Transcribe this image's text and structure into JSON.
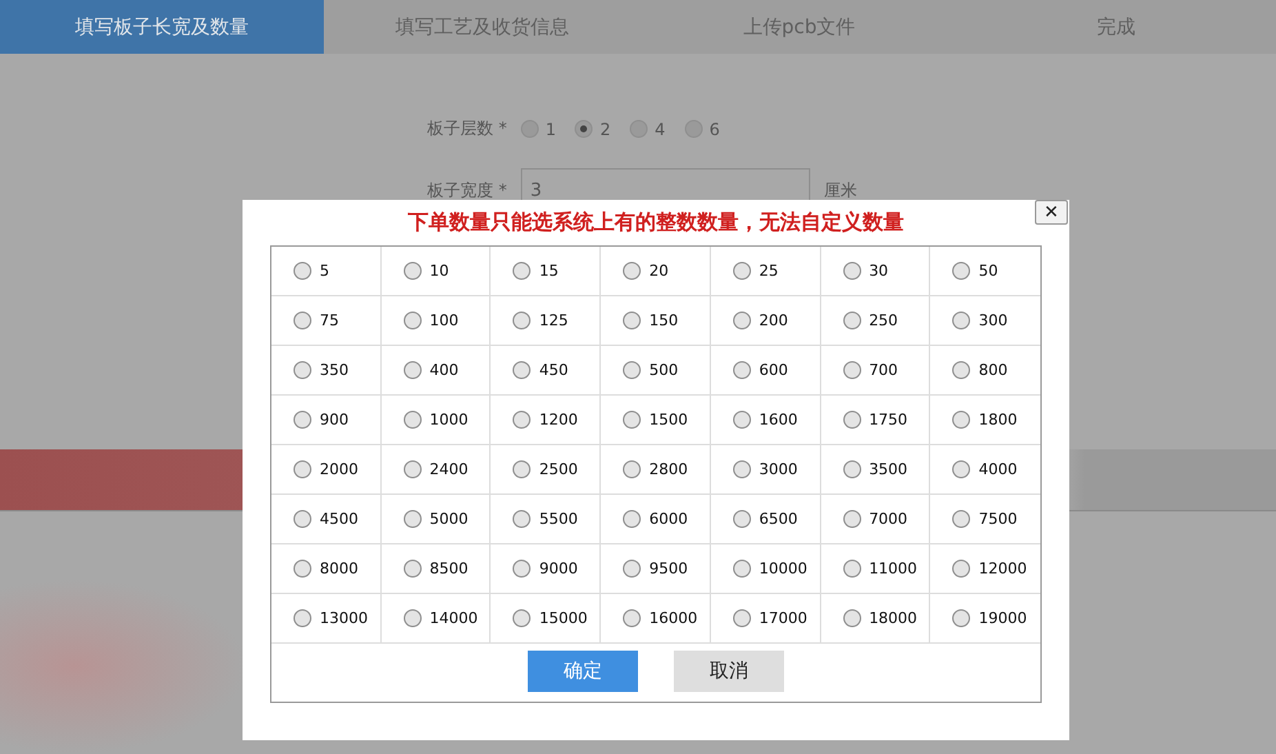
{
  "tabs": [
    {
      "label": "填写板子长宽及数量",
      "selected": true
    },
    {
      "label": "填写工艺及收货信息",
      "selected": false
    },
    {
      "label": "上传pcb文件",
      "selected": false
    },
    {
      "label": "完成",
      "selected": false
    }
  ],
  "form": {
    "layers": {
      "label": "板子层数 *",
      "options": [
        {
          "label": "1",
          "selected": false
        },
        {
          "label": "2",
          "selected": true
        },
        {
          "label": "4",
          "selected": false
        },
        {
          "label": "6",
          "selected": false
        }
      ]
    },
    "width": {
      "label": "板子宽度 *",
      "value": "3",
      "unit": "厘米"
    }
  },
  "modal": {
    "title": "下单数量只能选系统上有的整数数量，无法自定义数量",
    "close": "✕",
    "options": [
      {
        "label": "5",
        "selected": false
      },
      {
        "label": "10",
        "selected": false
      },
      {
        "label": "15",
        "selected": false
      },
      {
        "label": "20",
        "selected": false
      },
      {
        "label": "25",
        "selected": false
      },
      {
        "label": "30",
        "selected": false
      },
      {
        "label": "50",
        "selected": false
      },
      {
        "label": "75",
        "selected": false
      },
      {
        "label": "100",
        "selected": false
      },
      {
        "label": "125",
        "selected": false
      },
      {
        "label": "150",
        "selected": false
      },
      {
        "label": "200",
        "selected": false
      },
      {
        "label": "250",
        "selected": false
      },
      {
        "label": "300",
        "selected": false
      },
      {
        "label": "350",
        "selected": false
      },
      {
        "label": "400",
        "selected": false
      },
      {
        "label": "450",
        "selected": false
      },
      {
        "label": "500",
        "selected": false
      },
      {
        "label": "600",
        "selected": false
      },
      {
        "label": "700",
        "selected": false
      },
      {
        "label": "800",
        "selected": false
      },
      {
        "label": "900",
        "selected": false
      },
      {
        "label": "1000",
        "selected": false
      },
      {
        "label": "1200",
        "selected": false
      },
      {
        "label": "1500",
        "selected": false
      },
      {
        "label": "1600",
        "selected": false
      },
      {
        "label": "1750",
        "selected": false
      },
      {
        "label": "1800",
        "selected": false
      },
      {
        "label": "2000",
        "selected": false
      },
      {
        "label": "2400",
        "selected": false
      },
      {
        "label": "2500",
        "selected": false
      },
      {
        "label": "2800",
        "selected": false
      },
      {
        "label": "3000",
        "selected": false
      },
      {
        "label": "3500",
        "selected": false
      },
      {
        "label": "4000",
        "selected": false
      },
      {
        "label": "4500",
        "selected": false
      },
      {
        "label": "5000",
        "selected": false
      },
      {
        "label": "5500",
        "selected": false
      },
      {
        "label": "6000",
        "selected": false
      },
      {
        "label": "6500",
        "selected": false
      },
      {
        "label": "7000",
        "selected": false
      },
      {
        "label": "7500",
        "selected": false
      },
      {
        "label": "8000",
        "selected": false
      },
      {
        "label": "8500",
        "selected": false
      },
      {
        "label": "9000",
        "selected": false
      },
      {
        "label": "9500",
        "selected": false
      },
      {
        "label": "10000",
        "selected": false
      },
      {
        "label": "11000",
        "selected": false
      },
      {
        "label": "12000",
        "selected": false
      },
      {
        "label": "13000",
        "selected": false
      },
      {
        "label": "14000",
        "selected": false
      },
      {
        "label": "15000",
        "selected": false
      },
      {
        "label": "16000",
        "selected": false
      },
      {
        "label": "17000",
        "selected": false
      },
      {
        "label": "18000",
        "selected": false
      },
      {
        "label": "19000",
        "selected": false
      }
    ],
    "buttons": [
      {
        "label": "确定",
        "kind": "primary"
      },
      {
        "label": "取消",
        "kind": "secondary"
      }
    ]
  }
}
